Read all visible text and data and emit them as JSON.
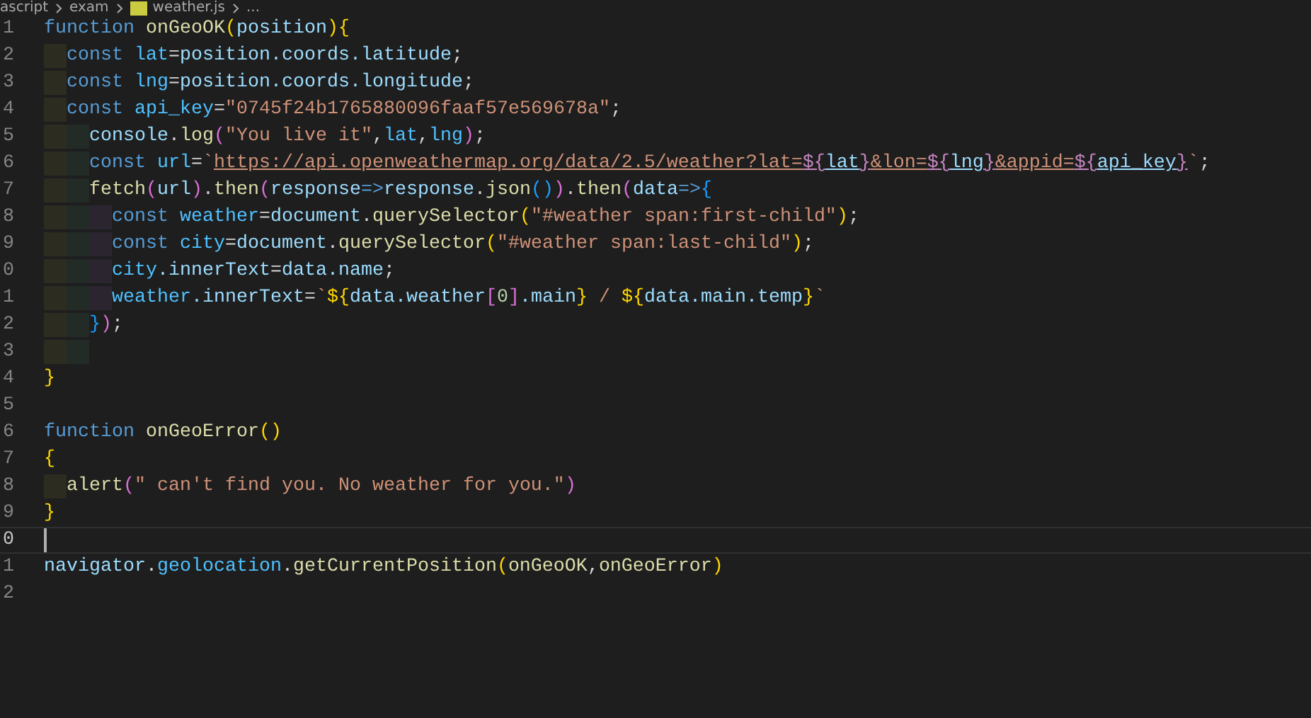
{
  "breadcrumb": [
    {
      "label": "ascript",
      "kind": "folder"
    },
    {
      "label": "exam",
      "kind": "folder"
    },
    {
      "label": "weather.js",
      "kind": "file"
    },
    {
      "label": "...",
      "kind": "more"
    }
  ],
  "lines": [
    {
      "number": "1",
      "current": false,
      "tokens": [
        {
          "text": "function ",
          "kind": "kw"
        },
        {
          "text": "onGeoOK",
          "kind": "fn"
        },
        {
          "text": "(",
          "kind": "b1"
        },
        {
          "text": "position",
          "kind": "var"
        },
        {
          "text": "){",
          "kind": "b1"
        }
      ]
    },
    {
      "number": "2",
      "current": false,
      "indent_guides": [
        {
          "color": "#2c2c21"
        }
      ],
      "tokens": [
        {
          "text": "const ",
          "kind": "kw"
        },
        {
          "text": "lat",
          "kind": "constant"
        },
        {
          "text": "=",
          "kind": "plain"
        },
        {
          "text": "position.coords.latitude",
          "kind": "var"
        },
        {
          "text": ";",
          "kind": "plain"
        }
      ]
    },
    {
      "number": "3",
      "current": false,
      "indent_guides": [
        {
          "color": "#2c2c21"
        }
      ],
      "tokens": [
        {
          "text": "const ",
          "kind": "kw"
        },
        {
          "text": "lng",
          "kind": "constant"
        },
        {
          "text": "=",
          "kind": "plain"
        },
        {
          "text": "position.coords.longitude",
          "kind": "var"
        },
        {
          "text": ";",
          "kind": "plain"
        }
      ]
    },
    {
      "number": "4",
      "current": false,
      "indent_guides": [
        {
          "color": "#2c2c21"
        }
      ],
      "tokens": [
        {
          "text": "const ",
          "kind": "kw"
        },
        {
          "text": "api_key",
          "kind": "constant"
        },
        {
          "text": "=",
          "kind": "plain"
        },
        {
          "text": "\"0745f24b1765880096faaf57e569678a\"",
          "kind": "str"
        },
        {
          "text": ";",
          "kind": "plain"
        }
      ]
    },
    {
      "number": "5",
      "current": false,
      "indent_guides": [
        {
          "color": "#2c2c21"
        },
        {
          "color": "#232b26"
        }
      ],
      "tokens": [
        {
          "text": "console",
          "kind": "var"
        },
        {
          "text": ".",
          "kind": "plain"
        },
        {
          "text": "log",
          "kind": "fn"
        },
        {
          "text": "(",
          "kind": "b2"
        },
        {
          "text": "\"You live it\"",
          "kind": "str"
        },
        {
          "text": ",",
          "kind": "plain"
        },
        {
          "text": "lat",
          "kind": "constant"
        },
        {
          "text": ",",
          "kind": "plain"
        },
        {
          "text": "lng",
          "kind": "constant"
        },
        {
          "text": ")",
          "kind": "b2"
        },
        {
          "text": ";",
          "kind": "plain"
        }
      ]
    },
    {
      "number": "6",
      "current": false,
      "indent_guides": [
        {
          "color": "#2c2c21"
        },
        {
          "color": "#232b26"
        }
      ],
      "tokens": [
        {
          "text": "const ",
          "kind": "kw"
        },
        {
          "text": "url",
          "kind": "constant"
        },
        {
          "text": "=",
          "kind": "plain"
        },
        {
          "text": "`",
          "kind": "str"
        },
        {
          "text": "https://api.openweathermap.org/data/2.5/weather?lat=",
          "kind": "link"
        },
        {
          "text": "${",
          "kind": "link-interp"
        },
        {
          "text": "lat",
          "kind": "link-var"
        },
        {
          "text": "}",
          "kind": "link-interp"
        },
        {
          "text": "&lon=",
          "kind": "link"
        },
        {
          "text": "${",
          "kind": "link-interp"
        },
        {
          "text": "lng",
          "kind": "link-var"
        },
        {
          "text": "}",
          "kind": "link-interp"
        },
        {
          "text": "&appid=",
          "kind": "link"
        },
        {
          "text": "${",
          "kind": "link-interp"
        },
        {
          "text": "api_key",
          "kind": "link-var"
        },
        {
          "text": "}",
          "kind": "link-interp"
        },
        {
          "text": "`",
          "kind": "str"
        },
        {
          "text": ";",
          "kind": "plain"
        }
      ]
    },
    {
      "number": "7",
      "current": false,
      "indent_guides": [
        {
          "color": "#2c2c21"
        },
        {
          "color": "#232b26"
        }
      ],
      "tokens": [
        {
          "text": "fetch",
          "kind": "fn"
        },
        {
          "text": "(",
          "kind": "b2"
        },
        {
          "text": "url",
          "kind": "var"
        },
        {
          "text": ")",
          "kind": "b2"
        },
        {
          "text": ".",
          "kind": "plain"
        },
        {
          "text": "then",
          "kind": "fn"
        },
        {
          "text": "(",
          "kind": "b2"
        },
        {
          "text": "response",
          "kind": "var"
        },
        {
          "text": "=>",
          "kind": "kw"
        },
        {
          "text": "response",
          "kind": "var"
        },
        {
          "text": ".",
          "kind": "plain"
        },
        {
          "text": "json",
          "kind": "fn"
        },
        {
          "text": "()",
          "kind": "b3"
        },
        {
          "text": ")",
          "kind": "b2"
        },
        {
          "text": ".",
          "kind": "plain"
        },
        {
          "text": "then",
          "kind": "fn"
        },
        {
          "text": "(",
          "kind": "b2"
        },
        {
          "text": "data",
          "kind": "var"
        },
        {
          "text": "=>",
          "kind": "kw"
        },
        {
          "text": "{",
          "kind": "b3"
        }
      ]
    },
    {
      "number": "8",
      "current": false,
      "indent_guides": [
        {
          "color": "#2c2c21"
        },
        {
          "color": "#232b26"
        },
        {
          "color": "#2b2530"
        }
      ],
      "tokens": [
        {
          "text": "const ",
          "kind": "kw"
        },
        {
          "text": "weather",
          "kind": "constant"
        },
        {
          "text": "=",
          "kind": "plain"
        },
        {
          "text": "document",
          "kind": "var"
        },
        {
          "text": ".",
          "kind": "plain"
        },
        {
          "text": "querySelector",
          "kind": "fn"
        },
        {
          "text": "(",
          "kind": "b1"
        },
        {
          "text": "\"#weather span:first-child\"",
          "kind": "str"
        },
        {
          "text": ")",
          "kind": "b1"
        },
        {
          "text": ";",
          "kind": "plain"
        }
      ]
    },
    {
      "number": "9",
      "current": false,
      "indent_guides": [
        {
          "color": "#2c2c21"
        },
        {
          "color": "#232b26"
        },
        {
          "color": "#2b2530"
        }
      ],
      "tokens": [
        {
          "text": "const ",
          "kind": "kw"
        },
        {
          "text": "city",
          "kind": "constant"
        },
        {
          "text": "=",
          "kind": "plain"
        },
        {
          "text": "document",
          "kind": "var"
        },
        {
          "text": ".",
          "kind": "plain"
        },
        {
          "text": "querySelector",
          "kind": "fn"
        },
        {
          "text": "(",
          "kind": "b1"
        },
        {
          "text": "\"#weather span:last-child\"",
          "kind": "str"
        },
        {
          "text": ")",
          "kind": "b1"
        },
        {
          "text": ";",
          "kind": "plain"
        }
      ]
    },
    {
      "number": "0",
      "current": false,
      "indent_guides": [
        {
          "color": "#2c2c21"
        },
        {
          "color": "#232b26"
        },
        {
          "color": "#2b2530"
        }
      ],
      "tokens": [
        {
          "text": "city",
          "kind": "constant"
        },
        {
          "text": ".innerText",
          "kind": "var"
        },
        {
          "text": "=",
          "kind": "plain"
        },
        {
          "text": "data.name",
          "kind": "var"
        },
        {
          "text": ";",
          "kind": "plain"
        }
      ]
    },
    {
      "number": "1",
      "current": false,
      "indent_guides": [
        {
          "color": "#2c2c21"
        },
        {
          "color": "#232b26"
        },
        {
          "color": "#2b2530"
        }
      ],
      "tokens": [
        {
          "text": "weather",
          "kind": "constant"
        },
        {
          "text": ".innerText",
          "kind": "var"
        },
        {
          "text": "=",
          "kind": "plain"
        },
        {
          "text": "`",
          "kind": "str"
        },
        {
          "text": "${",
          "kind": "b1"
        },
        {
          "text": "data.weather",
          "kind": "var"
        },
        {
          "text": "[",
          "kind": "b2"
        },
        {
          "text": "0",
          "kind": "num"
        },
        {
          "text": "]",
          "kind": "b2"
        },
        {
          "text": ".main",
          "kind": "var"
        },
        {
          "text": "}",
          "kind": "b1"
        },
        {
          "text": " / ",
          "kind": "str"
        },
        {
          "text": "${",
          "kind": "b1"
        },
        {
          "text": "data.main.temp",
          "kind": "var"
        },
        {
          "text": "}",
          "kind": "b1"
        },
        {
          "text": "`",
          "kind": "str"
        }
      ]
    },
    {
      "number": "2",
      "current": false,
      "indent_guides": [
        {
          "color": "#2c2c21"
        },
        {
          "color": "#232b26"
        }
      ],
      "tokens": [
        {
          "text": "}",
          "kind": "b3"
        },
        {
          "text": ")",
          "kind": "b2"
        },
        {
          "text": ";",
          "kind": "plain"
        }
      ]
    },
    {
      "number": "3",
      "current": false,
      "indent_guides": [
        {
          "color": "#2c2c21"
        },
        {
          "color": "#232b26"
        }
      ]
    },
    {
      "number": "4",
      "current": false,
      "tokens": [
        {
          "text": "}",
          "kind": "b1"
        }
      ]
    },
    {
      "number": "5",
      "current": false
    },
    {
      "number": "6",
      "current": false,
      "tokens": [
        {
          "text": "function ",
          "kind": "kw"
        },
        {
          "text": "onGeoError",
          "kind": "fn"
        },
        {
          "text": "()",
          "kind": "b1"
        }
      ]
    },
    {
      "number": "7",
      "current": false,
      "tokens": [
        {
          "text": "{",
          "kind": "b1"
        }
      ]
    },
    {
      "number": "8",
      "current": false,
      "indent_guides": [
        {
          "color": "#2c2c21"
        }
      ],
      "tokens": [
        {
          "text": "alert",
          "kind": "fn"
        },
        {
          "text": "(",
          "kind": "b2"
        },
        {
          "text": "\" can't find you. No weather for you.\"",
          "kind": "str"
        },
        {
          "text": ")",
          "kind": "b2"
        }
      ]
    },
    {
      "number": "9",
      "current": false,
      "tokens": [
        {
          "text": "}",
          "kind": "b1"
        }
      ]
    },
    {
      "number": "0",
      "current": true
    },
    {
      "number": "1",
      "current": false,
      "tokens": [
        {
          "text": "navigator",
          "kind": "var"
        },
        {
          "text": ".",
          "kind": "plain"
        },
        {
          "text": "geolocation",
          "kind": "constant"
        },
        {
          "text": ".",
          "kind": "plain"
        },
        {
          "text": "getCurrentPosition",
          "kind": "fn"
        },
        {
          "text": "(",
          "kind": "b1"
        },
        {
          "text": "onGeoOK",
          "kind": "fn"
        },
        {
          "text": ",",
          "kind": "plain"
        },
        {
          "text": "onGeoError",
          "kind": "fn"
        },
        {
          "text": ")",
          "kind": "b1"
        }
      ]
    },
    {
      "number": "2",
      "current": false
    }
  ]
}
